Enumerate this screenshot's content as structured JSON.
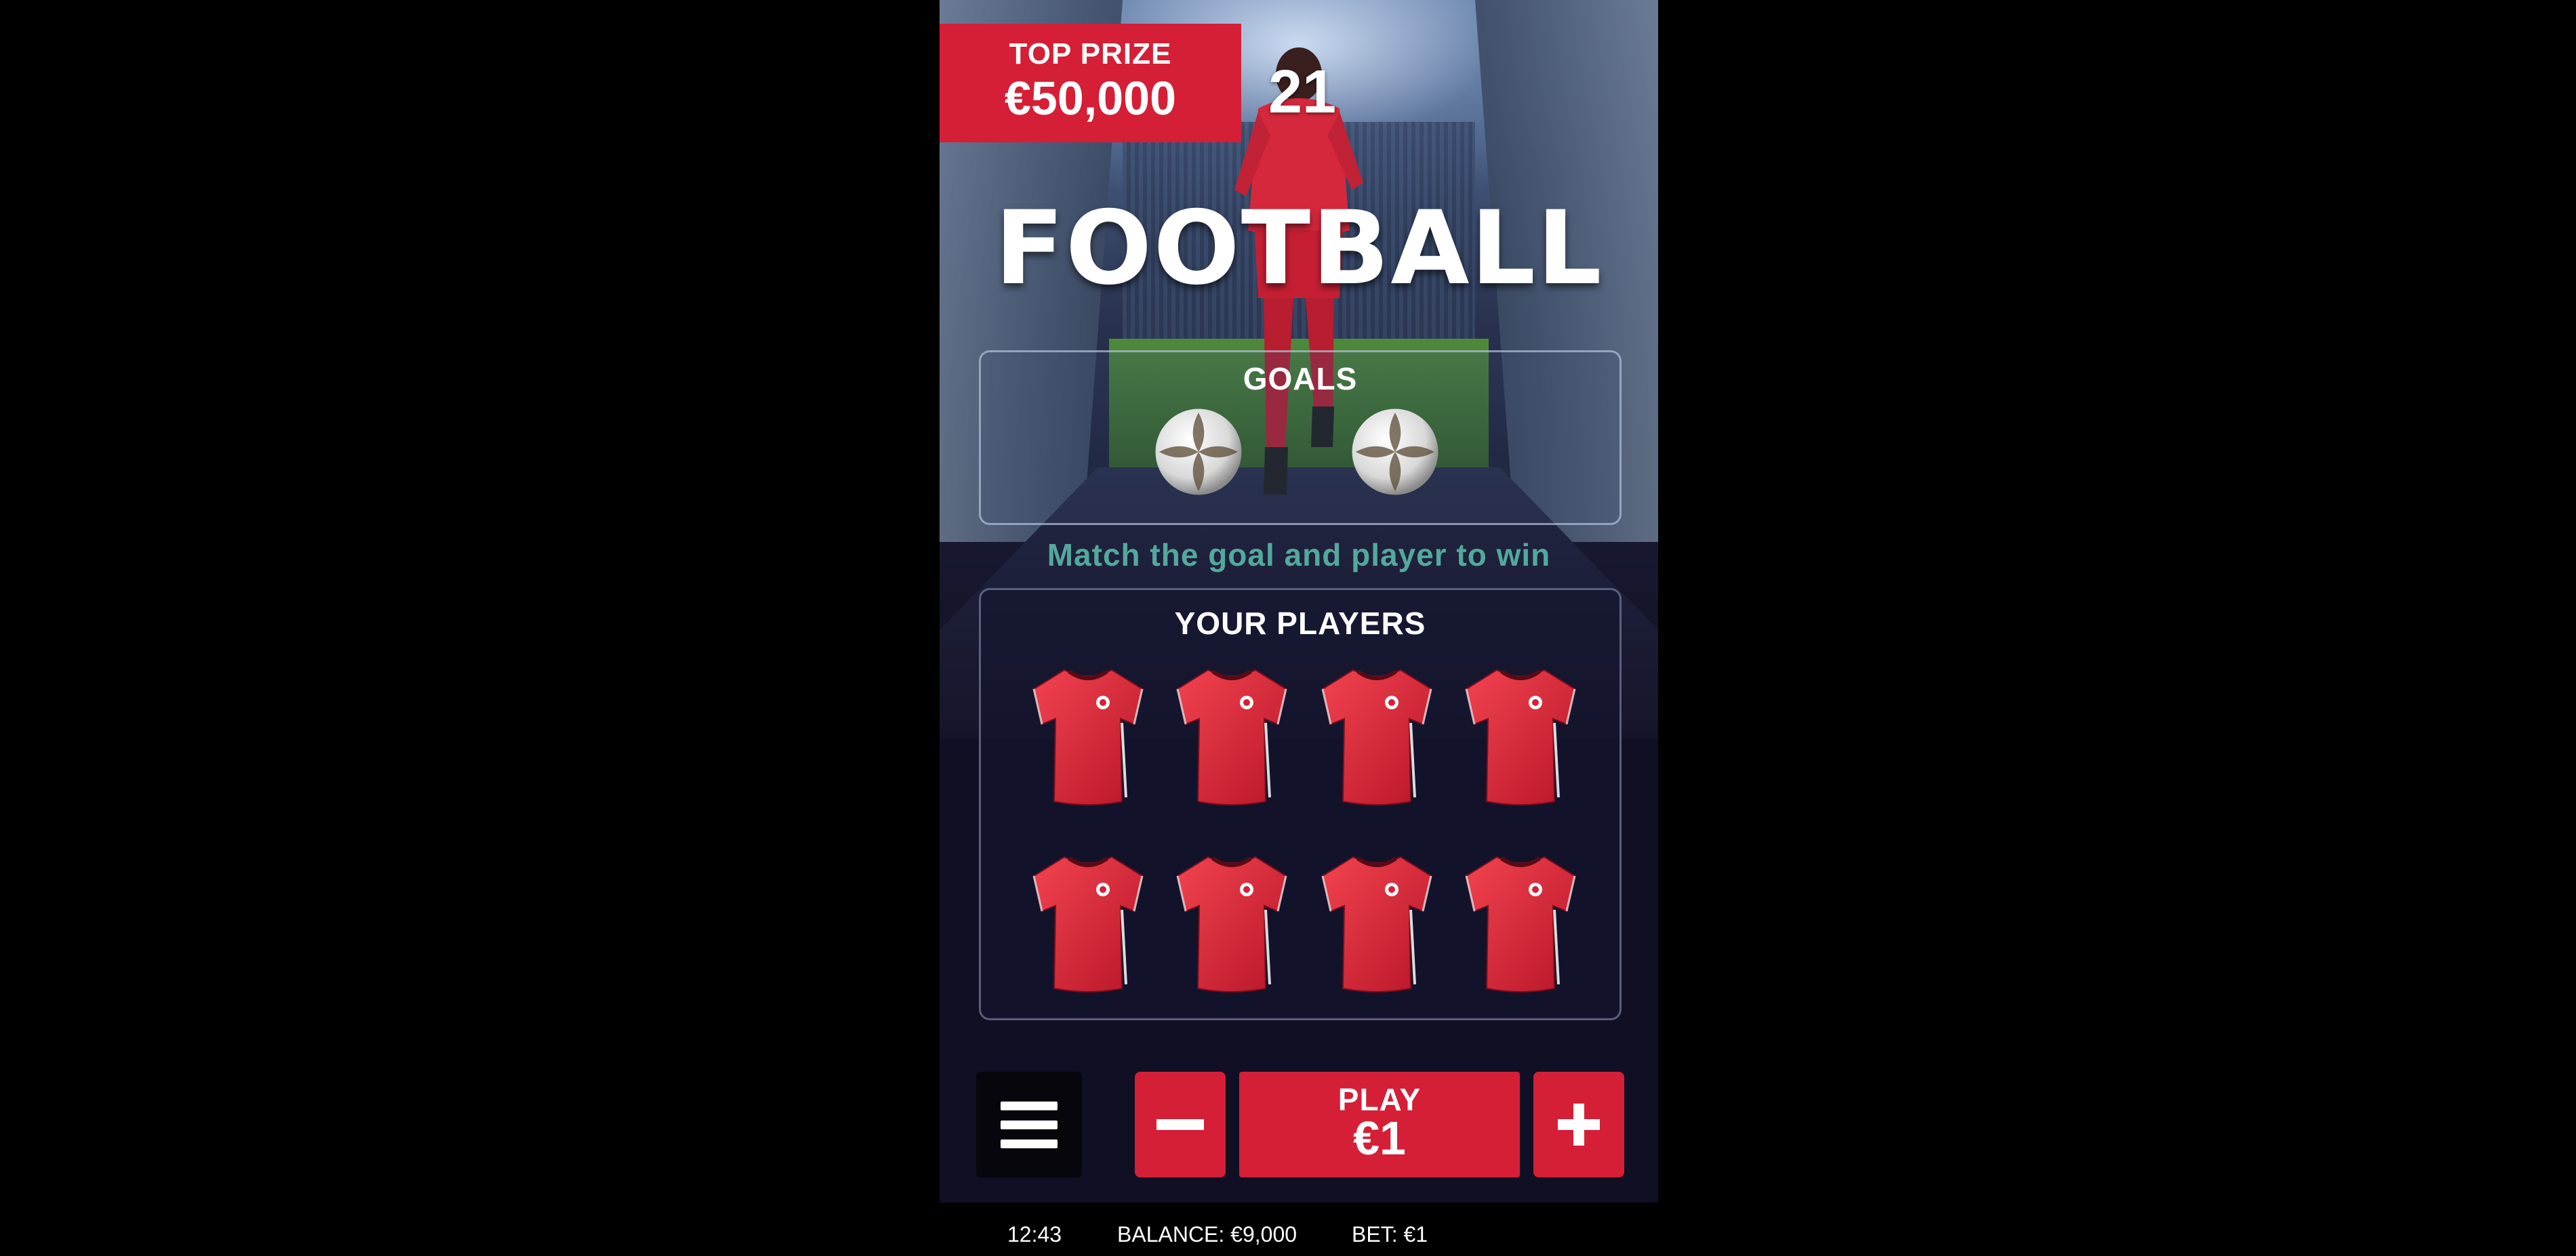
{
  "top_prize": {
    "label": "TOP PRIZE",
    "value": "€50,000"
  },
  "jersey_number": "21",
  "title": "FOOTBALL",
  "goals": {
    "title": "GOALS",
    "items": [
      "ball-icon",
      "ball-icon"
    ]
  },
  "instruction": "Match the goal and player to win",
  "players": {
    "title": "YOUR PLAYERS",
    "rows": 2,
    "cols": 4,
    "items": [
      "shirt-icon",
      "shirt-icon",
      "shirt-icon",
      "shirt-icon",
      "shirt-icon",
      "shirt-icon",
      "shirt-icon",
      "shirt-icon"
    ]
  },
  "controls": {
    "menu_icon": "hamburger-menu-icon",
    "minus_icon": "minus-icon",
    "play_label": "PLAY",
    "play_amount": "€1",
    "plus_icon": "plus-icon"
  },
  "status_bar": {
    "time": "12:43",
    "balance": "BALANCE: €9,000",
    "bet": "BET: €1"
  },
  "colors": {
    "accent_red": "#d41f36",
    "instruction_teal": "#54a89d",
    "background": "#000000",
    "panel_dark": "#110f24"
  }
}
